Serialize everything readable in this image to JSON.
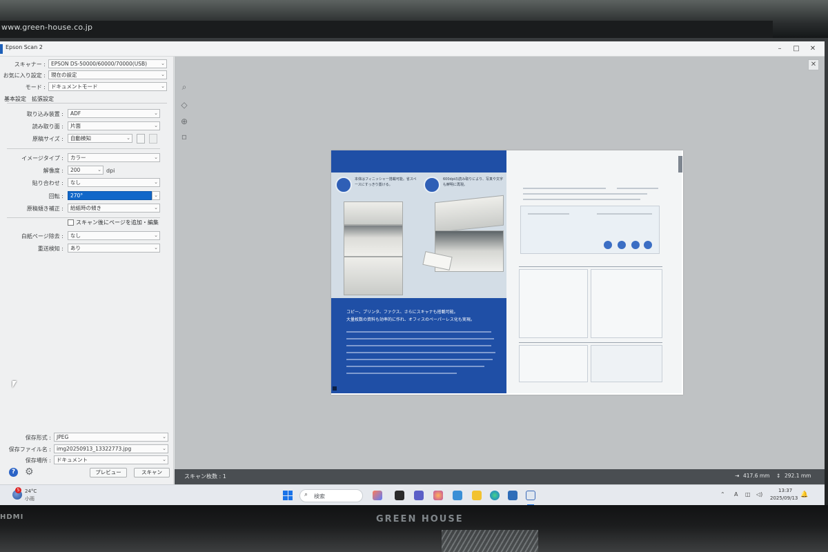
{
  "bezel": {
    "url": "www.green-house.co.jp",
    "hdmi": "HDMI",
    "brand": "GREEN HOUSE"
  },
  "window": {
    "title": "Epson Scan 2",
    "minimize": "–",
    "maximize": "□",
    "close": "✕"
  },
  "left_panel": {
    "scanner_label": "スキャナー :",
    "scanner_value": "EPSON DS-50000/60000/70000(USB)",
    "preset_label": "お気に入り設定 :",
    "preset_value": "現在の設定",
    "mode_label": "モード :",
    "mode_value": "ドキュメントモード",
    "tab_basic": "基本設定",
    "tab_advanced": "拡張設定",
    "source_label": "取り込み装置 :",
    "source_value": "ADF",
    "sides_label": "読み取り面 :",
    "sides_value": "片面",
    "docsize_label": "原稿サイズ :",
    "docsize_value": "自動検知",
    "imagetype_label": "イメージタイプ :",
    "imagetype_value": "カラー",
    "resolution_label": "解像度 :",
    "resolution_value": "200",
    "resolution_unit": "dpi",
    "stitch_label": "貼り合わせ :",
    "stitch_value": "なし",
    "rotate_label": "回転 :",
    "rotate_value": "270°",
    "skew_label": "原稿傾き補正 :",
    "skew_value": "給紙時の傾き",
    "add_pages_label": "スキャン後にページを追加・編集",
    "blank_skip_label": "白紙ページ除去 :",
    "blank_skip_value": "なし",
    "double_feed_label": "重送検知 :",
    "double_feed_value": "あり",
    "format_label": "保存形式 :",
    "format_value": "JPEG",
    "filename_label": "保存ファイル名 :",
    "filename_value": "img20250913_13322773.jpg",
    "folder_label": "保存場所 :",
    "folder_value": "ドキュメント",
    "preview_button": "プレビュー",
    "scan_button": "スキャン"
  },
  "preview": {
    "status_text": "スキャン枚数 : 1",
    "width_value": "417.6 mm",
    "height_value": "292.1 mm",
    "document": {
      "headline_1": "本体はフィニッシャー搭載可能。省スペースにすっきり置ける。",
      "headline_2": "600dpiの読み取りにより、写真や文字も鮮明に再現。",
      "blue_title_1": "コピー、プリンタ、ファクス、さらにスキャナも搭載可能。",
      "blue_title_2": "大量枚数の資料も効率的に作れ、オフィスのペーパーレス化も実現。"
    }
  },
  "taskbar": {
    "weather_badge": "5",
    "weather_temp": "24°C",
    "weather_cond": "小雨",
    "search_placeholder": "検索",
    "ime": "A",
    "time": "13:37",
    "date": "2025/09/13"
  }
}
